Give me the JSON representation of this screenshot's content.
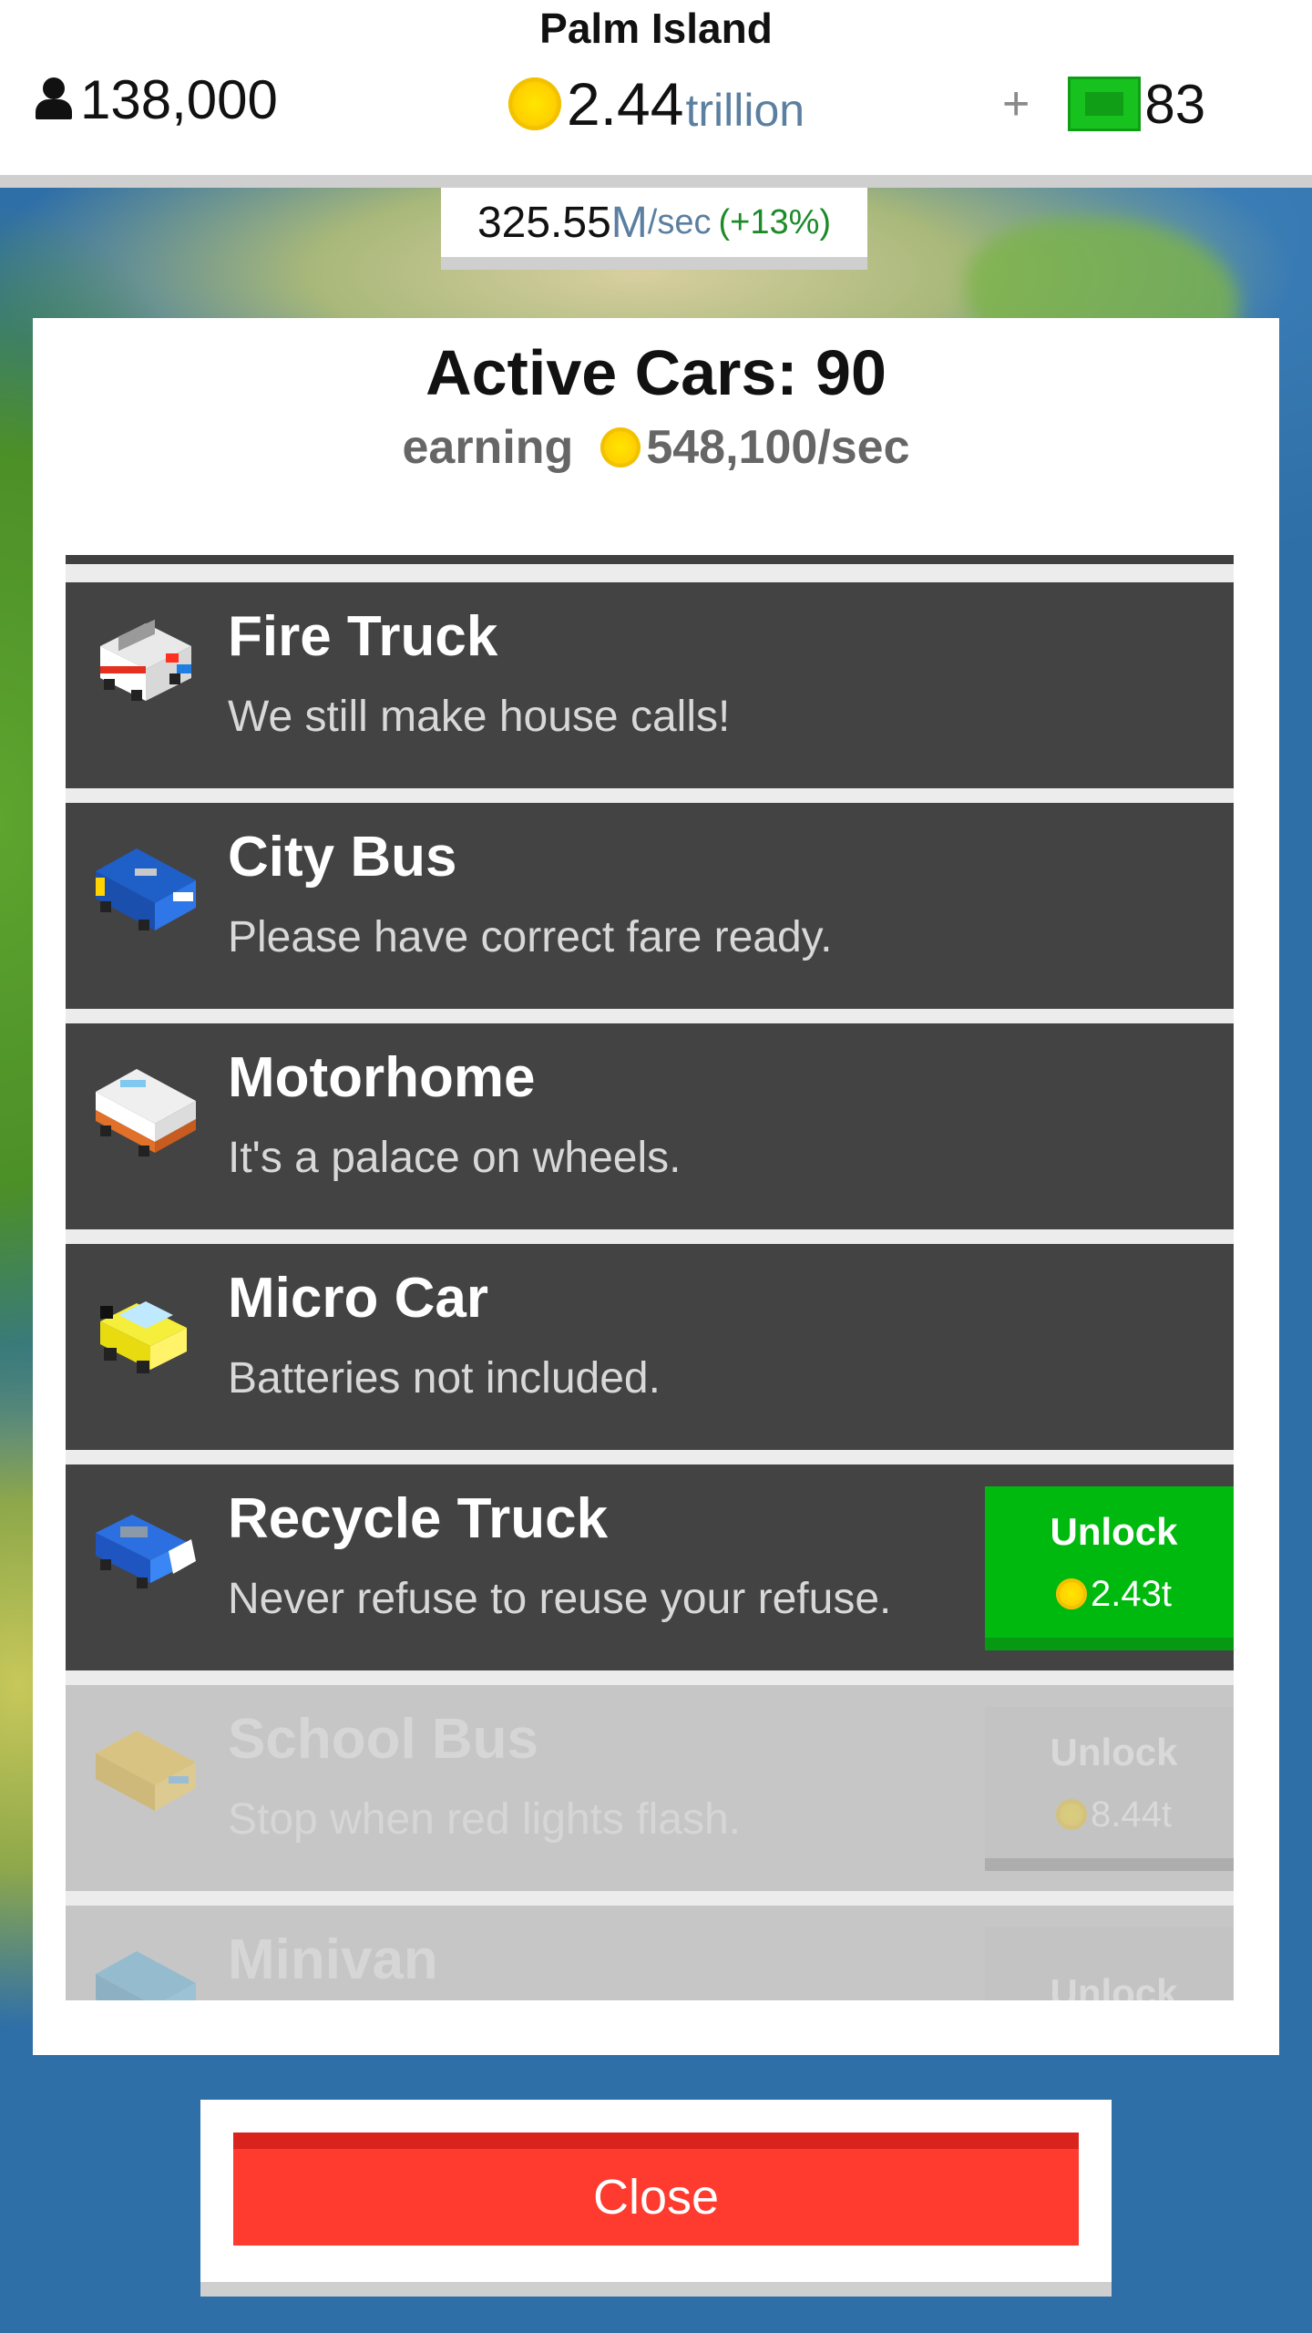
{
  "header": {
    "island_name": "Palm Island",
    "population": "138,000",
    "money_amount": "2.44",
    "money_unit": "trillion",
    "cash_plus": "+",
    "cash_count": "83",
    "rate_value": "325.55",
    "rate_unit": "M",
    "rate_per": "/sec",
    "rate_bonus": "(+13%)"
  },
  "panel": {
    "title": "Active Cars: 90",
    "earning_label": "earning",
    "earning_value": "548,100/sec"
  },
  "vehicles": [
    {
      "name": "Fire Truck",
      "desc": "We still make house calls!",
      "icon": "fire-truck-icon",
      "locked": false
    },
    {
      "name": "City Bus",
      "desc": "Please have correct fare ready.",
      "icon": "city-bus-icon",
      "locked": false
    },
    {
      "name": "Motorhome",
      "desc": "It's a palace on wheels.",
      "icon": "motorhome-icon",
      "locked": false
    },
    {
      "name": "Micro Car",
      "desc": "Batteries not included.",
      "icon": "micro-car-icon",
      "locked": false
    },
    {
      "name": "Recycle Truck",
      "desc": "Never refuse to reuse your refuse.",
      "icon": "recycle-truck-icon",
      "locked": false,
      "unlock_label": "Unlock",
      "price": "2.43t"
    },
    {
      "name": "School Bus",
      "desc": "Stop when red lights flash.",
      "icon": "school-bus-icon",
      "locked": true,
      "unlock_label": "Unlock",
      "price": "8.44t"
    },
    {
      "name": "Minivan",
      "desc": "",
      "icon": "minivan-icon",
      "locked": true,
      "unlock_label": "Unlock"
    }
  ],
  "close_label": "Close",
  "colors": {
    "unlock_green": "#00b90f",
    "close_red": "#ff3b30",
    "item_dark": "#434343",
    "item_locked": "#c6c6c6",
    "coin_gold": "#ffd000"
  }
}
